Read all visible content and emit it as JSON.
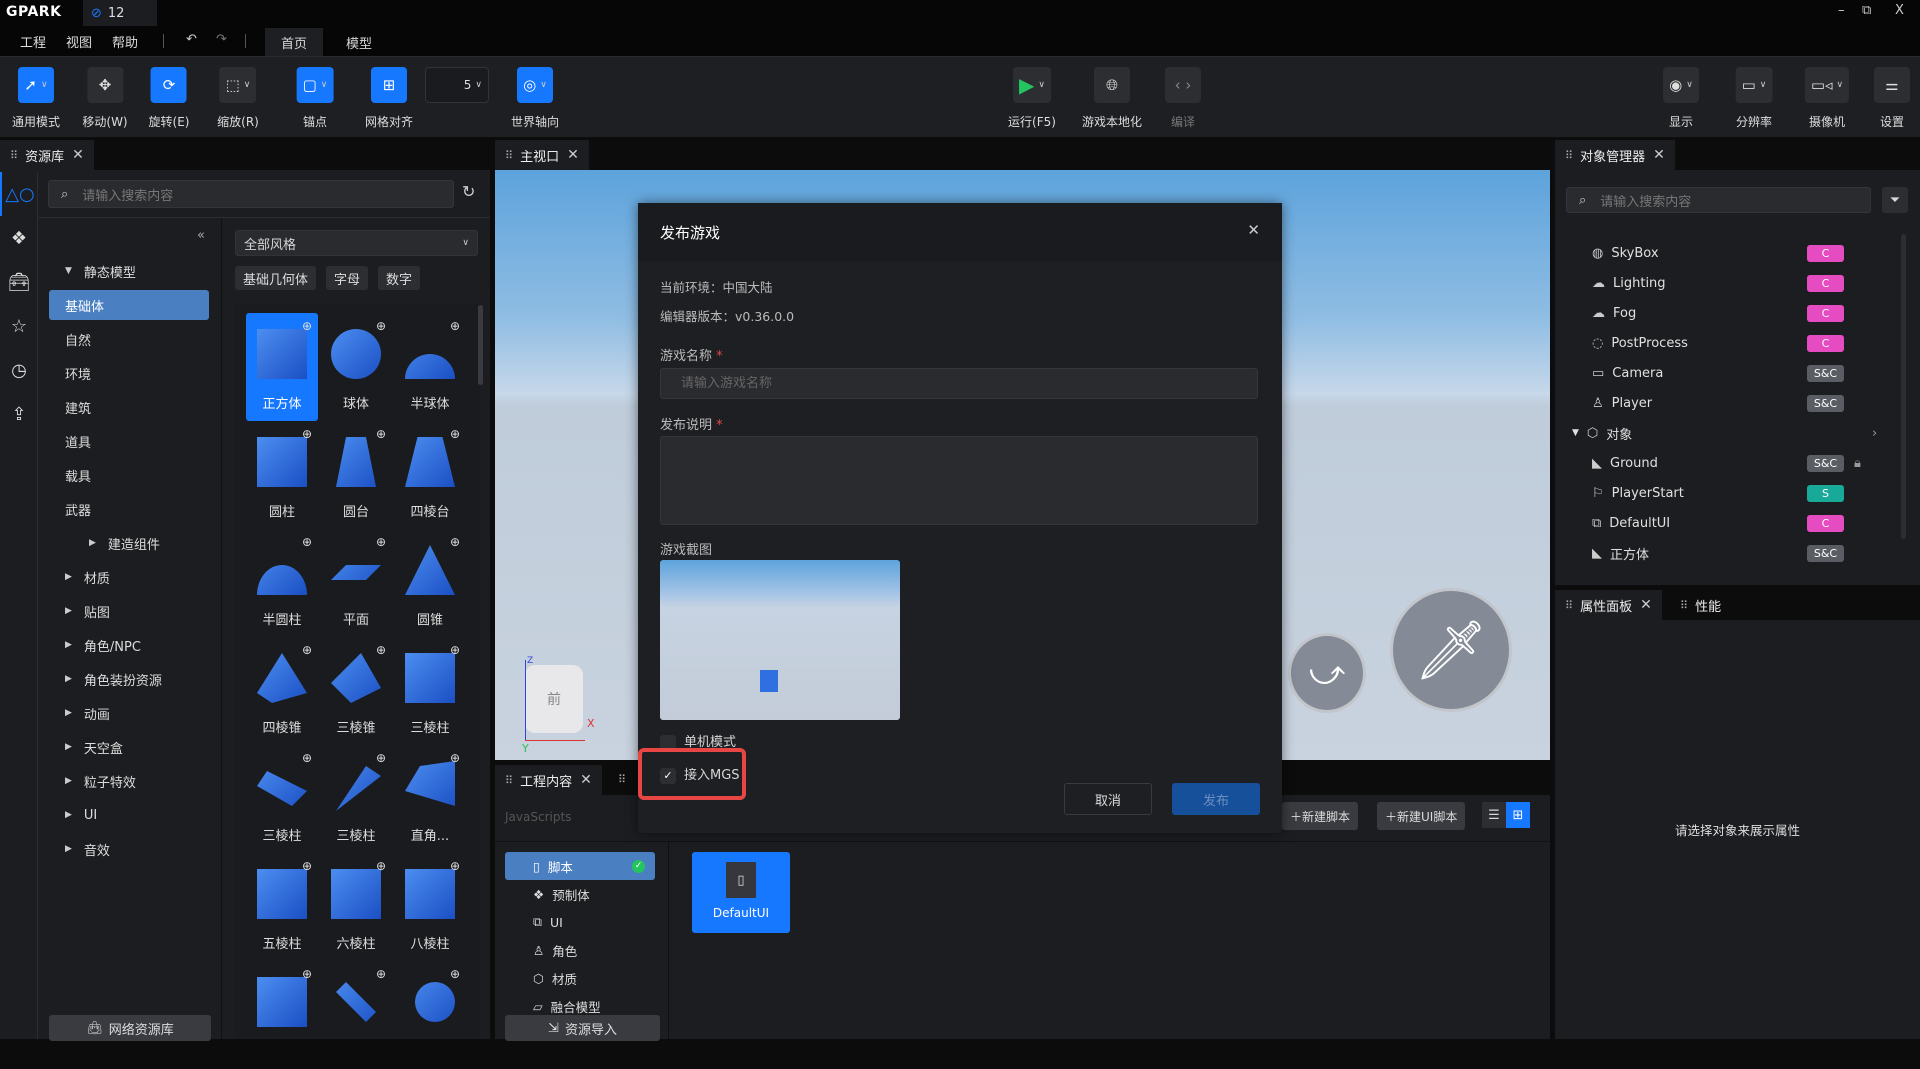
{
  "app": {
    "logo": "GPARK",
    "project_tab": "12",
    "window": {
      "minimize": "–",
      "restore": "⧉",
      "close": "X"
    }
  },
  "menu": [
    "工程",
    "视图",
    "帮助"
  ],
  "top_tabs": [
    {
      "label": "首页",
      "active": true
    },
    {
      "label": "模型",
      "active": false
    }
  ],
  "toolbar": {
    "left": [
      {
        "label": "通用模式",
        "icon": "cursor-icon",
        "active": true,
        "dropdown": true
      },
      {
        "label": "移动(W)",
        "icon": "move-icon",
        "active": false
      },
      {
        "label": "旋转(E)",
        "icon": "rotate-icon",
        "active": true
      },
      {
        "label": "缩放(R)",
        "icon": "scale-icon",
        "active": false,
        "dropdown": true
      },
      {
        "label": "锚点",
        "icon": "anchor-icon",
        "active": true,
        "dropdown": true
      },
      {
        "label": "网格对齐",
        "icon": "grid-icon",
        "active": true
      },
      {
        "label": "",
        "value": "5",
        "dropdown": true
      },
      {
        "label": "世界轴向",
        "icon": "world-axis-icon",
        "active": true,
        "dropdown": true
      }
    ],
    "center": [
      {
        "label": "运行(F5)",
        "icon": "play-icon"
      },
      {
        "label": "游戏本地化",
        "icon": "globe-icon"
      },
      {
        "label": "编译",
        "icon": "code-icon",
        "disabled": true
      }
    ],
    "right": [
      {
        "label": "显示",
        "icon": "eye-icon"
      },
      {
        "label": "分辨率",
        "icon": "monitor-icon"
      },
      {
        "label": "摄像机",
        "icon": "camera-icon"
      },
      {
        "label": "设置",
        "icon": "sliders-icon"
      }
    ]
  },
  "asset_panel": {
    "tab": "资源库",
    "search_placeholder": "请输入搜索内容",
    "style_select": "全部风格",
    "filters": [
      "基础几何体",
      "字母",
      "数字"
    ],
    "tree": [
      {
        "label": "静态模型",
        "expanded": true,
        "indent": 0
      },
      {
        "label": "基础体",
        "selected": true,
        "indent": 1
      },
      {
        "label": "自然",
        "indent": 1
      },
      {
        "label": "环境",
        "indent": 1
      },
      {
        "label": "建筑",
        "indent": 1
      },
      {
        "label": "道具",
        "indent": 1
      },
      {
        "label": "载具",
        "indent": 1
      },
      {
        "label": "武器",
        "indent": 1
      },
      {
        "label": "建造组件",
        "indent": 2,
        "collapsed": true
      },
      {
        "label": "材质",
        "collapsed": true,
        "indent": 0
      },
      {
        "label": "贴图",
        "collapsed": true,
        "indent": 0
      },
      {
        "label": "角色/NPC",
        "collapsed": true,
        "indent": 0
      },
      {
        "label": "角色装扮资源",
        "collapsed": true,
        "indent": 0
      },
      {
        "label": "动画",
        "collapsed": true,
        "indent": 0
      },
      {
        "label": "天空盒",
        "collapsed": true,
        "indent": 0
      },
      {
        "label": "粒子特效",
        "collapsed": true,
        "indent": 0
      },
      {
        "label": "UI",
        "collapsed": true,
        "indent": 0
      },
      {
        "label": "音效",
        "collapsed": true,
        "indent": 0
      }
    ],
    "assets": [
      "正方体",
      "球体",
      "半球体",
      "圆柱",
      "圆台",
      "四棱台",
      "半圆柱",
      "平面",
      "圆锥",
      "四棱锥",
      "三棱锥",
      "三棱柱",
      "三棱柱",
      "三棱柱",
      "直角...",
      "五棱柱",
      "六棱柱",
      "八棱柱",
      "",
      "",
      ""
    ],
    "online_button": "网络资源库"
  },
  "viewport": {
    "tab": "主视口",
    "gizmo_label": "前",
    "axis_x": "X",
    "axis_y": "Y",
    "axis_z": "Z"
  },
  "dialog": {
    "title": "发布游戏",
    "env": "当前环境：中国大陆",
    "version": "编辑器版本：v0.36.0.0",
    "name_label": "游戏名称",
    "name_placeholder": "请输入游戏名称",
    "desc_label": "发布说明",
    "screenshot_label": "游戏截图",
    "single_mode": {
      "label": "单机模式",
      "checked": false
    },
    "mgs": {
      "label": "接入MGS",
      "checked": true
    },
    "cancel": "取消",
    "publish": "发布",
    "required": "*",
    "highlight_color": "#e84545"
  },
  "project_panel": {
    "tab": "工程内容",
    "section": "JavaScripts",
    "new_script": "新建脚本",
    "new_ui_script": "新建UI脚本",
    "tree": [
      {
        "label": "脚本",
        "selected": true,
        "icon": "file-icon"
      },
      {
        "label": "预制体",
        "icon": "prefab-icon"
      },
      {
        "label": "UI",
        "icon": "ui-icon"
      },
      {
        "label": "角色",
        "icon": "character-icon"
      },
      {
        "label": "材质",
        "icon": "material-icon"
      },
      {
        "label": "融合模型",
        "icon": "merge-model-icon"
      }
    ],
    "import_button": "资源导入",
    "files": [
      "DefaultUI"
    ]
  },
  "object_panel": {
    "tab": "对象管理器",
    "search_placeholder": "请输入搜索内容",
    "items": [
      {
        "label": "SkyBox",
        "icon": "globe-icon",
        "badge": "C"
      },
      {
        "label": "Lighting",
        "icon": "cloud-icon",
        "badge": "C"
      },
      {
        "label": "Fog",
        "icon": "fog-icon",
        "badge": "C"
      },
      {
        "label": "PostProcess",
        "icon": "palette-icon",
        "badge": "C"
      },
      {
        "label": "Camera",
        "icon": "camera-icon",
        "badge": "S&C"
      },
      {
        "label": "Player",
        "icon": "player-icon",
        "badge": "S&C"
      },
      {
        "label": "对象",
        "icon": "cube-icon",
        "group": true
      },
      {
        "label": "Ground",
        "icon": "model-icon",
        "badge": "S&C",
        "locked": true
      },
      {
        "label": "PlayerStart",
        "icon": "flag-icon",
        "badge": "S"
      },
      {
        "label": "DefaultUI",
        "icon": "ui-icon",
        "badge": "C"
      },
      {
        "label": "正方体",
        "icon": "model-icon",
        "badge": "S&C"
      }
    ],
    "badge_colors": {
      "C": "#e64cc1",
      "S&C": "#5a5d63",
      "S": "#19a998"
    }
  },
  "property_panel": {
    "tab": "属性面板",
    "tab2": "性能",
    "empty": "请选择对象来展示属性"
  },
  "colors": {
    "accent": "#1677ff",
    "selected_tree": "#4a7fc1",
    "run_green": "#22c55e"
  }
}
